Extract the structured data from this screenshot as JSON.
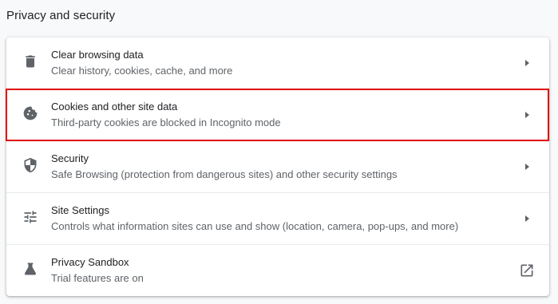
{
  "section": {
    "title": "Privacy and security"
  },
  "rows": [
    {
      "label": "Clear browsing data",
      "sublabel": "Clear history, cookies, cache, and more",
      "icon": "trash-icon",
      "trailing_icon": "arrow-right-icon"
    },
    {
      "label": "Cookies and other site data",
      "sublabel": "Third-party cookies are blocked in Incognito mode",
      "icon": "cookie-icon",
      "trailing_icon": "arrow-right-icon",
      "highlighted": true
    },
    {
      "label": "Security",
      "sublabel": "Safe Browsing (protection from dangerous sites) and other security settings",
      "icon": "shield-icon",
      "trailing_icon": "arrow-right-icon"
    },
    {
      "label": "Site Settings",
      "sublabel": "Controls what information sites can use and show (location, camera, pop-ups, and more)",
      "icon": "tune-icon",
      "trailing_icon": "arrow-right-icon"
    },
    {
      "label": "Privacy Sandbox",
      "sublabel": "Trial features are on",
      "icon": "flask-icon",
      "trailing_icon": "open-in-new-icon"
    }
  ],
  "colors": {
    "highlight": "#e00000",
    "icon": "#5f6368",
    "text_primary": "#202124",
    "text_secondary": "#5f6368"
  }
}
